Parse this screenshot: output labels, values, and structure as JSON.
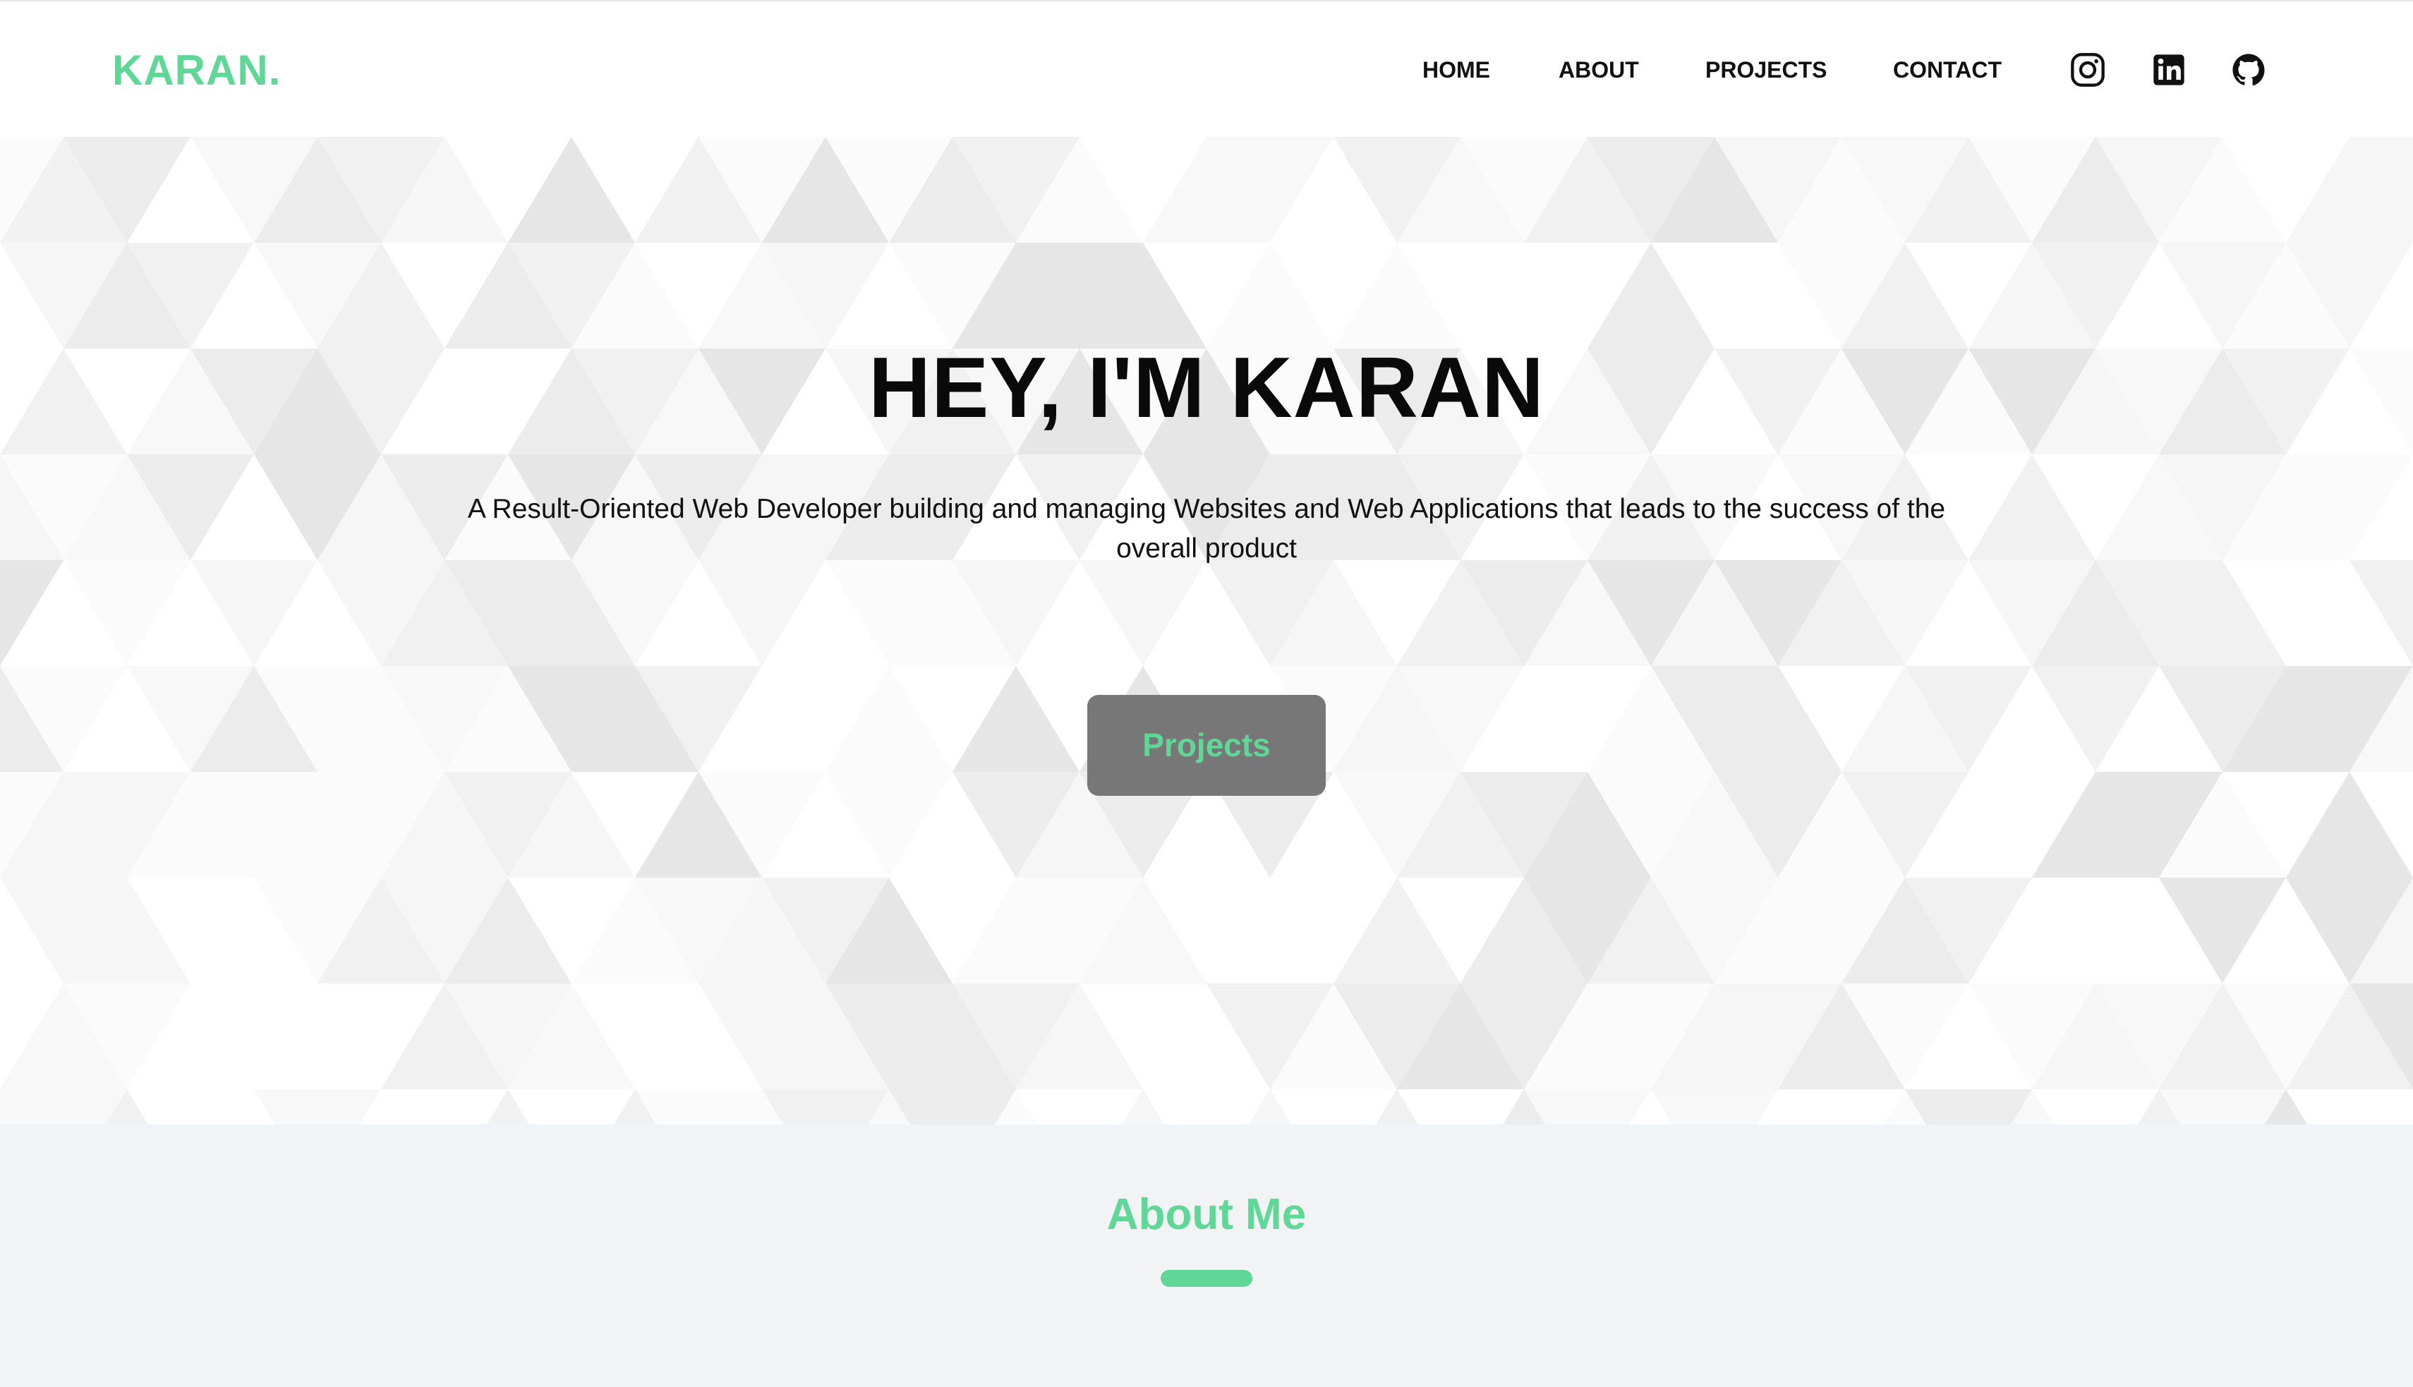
{
  "colors": {
    "accent": "#5fd796",
    "button_bg": "#777777",
    "text": "#111111",
    "about_bg": "#f2f3f5"
  },
  "header": {
    "brand": "KARAN.",
    "nav": [
      {
        "label": "HOME"
      },
      {
        "label": "ABOUT"
      },
      {
        "label": "PROJECTS"
      },
      {
        "label": "CONTACT"
      }
    ],
    "social": [
      {
        "icon": "instagram-icon"
      },
      {
        "icon": "linkedin-icon"
      },
      {
        "icon": "github-icon"
      }
    ]
  },
  "hero": {
    "title": "HEY, I'M KARAN",
    "subtitle": "A Result-Oriented Web Developer building and managing Websites and Web Applications that leads to the success of the overall product",
    "cta_label": "Projects"
  },
  "about": {
    "title": "About Me"
  }
}
